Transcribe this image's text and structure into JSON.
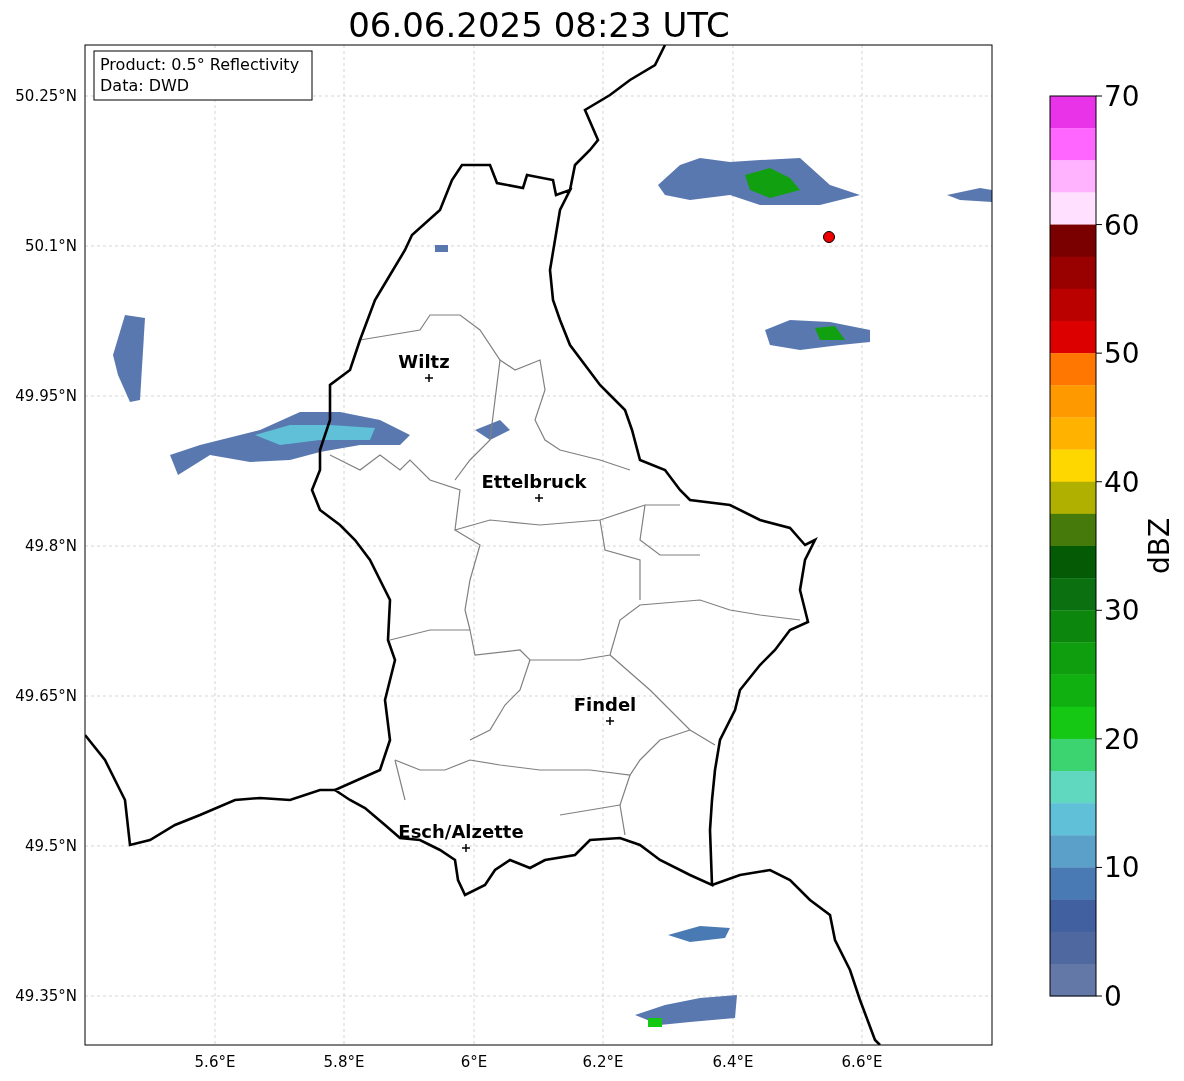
{
  "title": "06.06.2025 08:23 UTC",
  "info_box": {
    "lines": [
      "Product: 0.5° Reflectivity",
      "Data: DWD"
    ]
  },
  "map": {
    "lat_ticks": [
      "50.25°N",
      "50.1°N",
      "49.95°N",
      "49.8°N",
      "49.65°N",
      "49.5°N",
      "49.35°N"
    ],
    "lon_ticks": [
      "5.6°E",
      "5.8°E",
      "6°E",
      "6.2°E",
      "6.4°E",
      "6.6°E"
    ],
    "places": [
      {
        "label": "Wiltz"
      },
      {
        "label": "Ettelbruck"
      },
      {
        "label": "Findel"
      },
      {
        "label": "Esch/Alzette"
      }
    ]
  },
  "colorbar": {
    "label": "dBZ",
    "ticks": [
      "70",
      "60",
      "50",
      "40",
      "30",
      "20",
      "10",
      "0"
    ],
    "segments": [
      {
        "color": "#e933e9"
      },
      {
        "color": "#ff66ff"
      },
      {
        "color": "#ffb3ff"
      },
      {
        "color": "#ffe0ff"
      },
      {
        "color": "#7a0000"
      },
      {
        "color": "#990000"
      },
      {
        "color": "#bb0000"
      },
      {
        "color": "#dd0000"
      },
      {
        "color": "#ff7700"
      },
      {
        "color": "#ff9900"
      },
      {
        "color": "#ffb300"
      },
      {
        "color": "#ffd700"
      },
      {
        "color": "#b0b000"
      },
      {
        "color": "#467a0a"
      },
      {
        "color": "#055a05"
      },
      {
        "color": "#0a7010"
      },
      {
        "color": "#0c860c"
      },
      {
        "color": "#0e9e0e"
      },
      {
        "color": "#10b010"
      },
      {
        "color": "#14c814"
      },
      {
        "color": "#3cd470"
      },
      {
        "color": "#60d8c0"
      },
      {
        "color": "#60c0d8"
      },
      {
        "color": "#5aa0c8"
      },
      {
        "color": "#4a7ab4"
      },
      {
        "color": "#4060a0"
      },
      {
        "color": "#5068a0"
      },
      {
        "color": "#6478a8"
      }
    ]
  }
}
